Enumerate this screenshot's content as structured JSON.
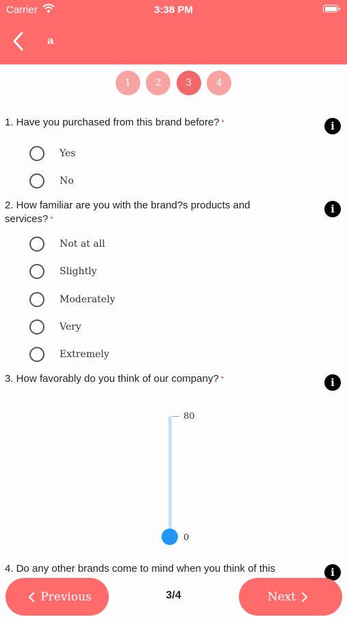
{
  "status_bar": {
    "carrier": "Carrier",
    "time": "3:38 PM"
  },
  "header": {
    "title": "a",
    "background": "#ff6b6b"
  },
  "steps": [
    {
      "label": "1",
      "active": false
    },
    {
      "label": "2",
      "active": false
    },
    {
      "label": "3",
      "active": true
    },
    {
      "label": "4",
      "active": false
    }
  ],
  "questions": [
    {
      "text": "1. Have you purchased from this brand before?",
      "required": "*",
      "options": [
        "Yes",
        "No"
      ]
    },
    {
      "text": "2. How familiar are you with the brand?s products and services?",
      "required": "*",
      "options": [
        "Not at all",
        "Slightly",
        "Moderately",
        "Very",
        "Extremely"
      ]
    },
    {
      "text": "3. How favorably do you think of our company?",
      "required": "*",
      "slider": {
        "max": "80",
        "min": "0",
        "value": 0
      }
    },
    {
      "text": "4. Do any other brands come to mind when you think of this"
    }
  ],
  "info_icon": "i",
  "footer": {
    "previous_label": "Previous",
    "next_label": "Next",
    "page_indicator": "3/4"
  },
  "icons": {
    "back": "chevron-left",
    "wifi": "wifi",
    "battery": "battery",
    "info": "info-circle"
  }
}
